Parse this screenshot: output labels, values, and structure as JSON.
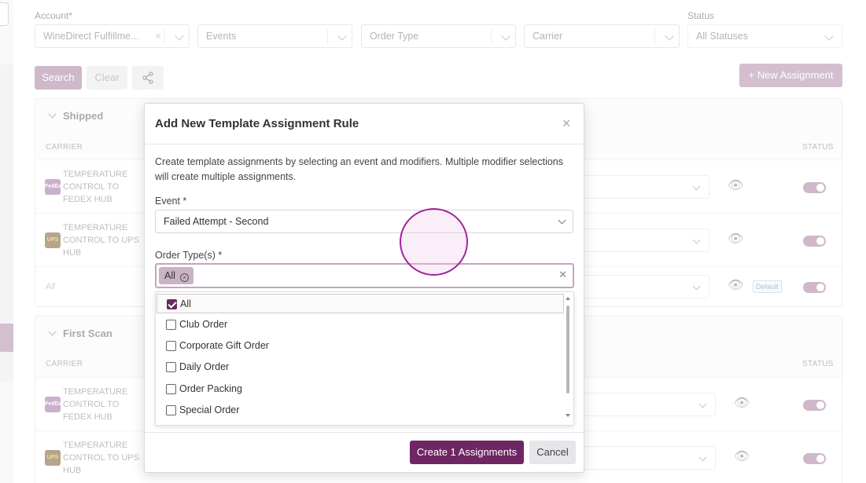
{
  "filters": {
    "account_label": "Account*",
    "account_value": "WineDirect Fulfillme...",
    "events_placeholder": "Events",
    "order_type_placeholder": "Order Type",
    "carrier_placeholder": "Carrier",
    "status_label": "Status",
    "status_value": "All Statuses"
  },
  "toolbar": {
    "search_label": "Search",
    "clear_label": "Clear",
    "new_assignment_label": "+ New Assignment"
  },
  "sections": [
    {
      "title": "Shipped",
      "col_carrier": "CARRIER",
      "col_status": "STATUS",
      "rows": [
        {
          "carrier": "TEMPERATURE CONTROL TO FEDEX HUB",
          "logo": "FedEx"
        },
        {
          "carrier": "TEMPERATURE CONTROL TO UPS HUB",
          "logo": "UPS"
        },
        {
          "carrier": "All",
          "badge": "Default"
        }
      ]
    },
    {
      "title": "First Scan",
      "col_carrier": "CARRIER",
      "col_status": "STATUS",
      "rows": [
        {
          "carrier": "TEMPERATURE CONTROL TO FEDEX HUB",
          "logo": "FedEx"
        },
        {
          "carrier": "TEMPERATURE CONTROL TO UPS HUB",
          "logo": "UPS"
        }
      ]
    }
  ],
  "modal": {
    "title": "Add New Template Assignment Rule",
    "description": "Create template assignments by selecting an event and modifiers. Multiple modifier selections will create multiple assignments.",
    "event_label": "Event *",
    "event_value": "Failed Attempt - Second",
    "order_types_label": "Order Type(s) *",
    "chip_label": "All",
    "options": [
      {
        "label": "All",
        "checked": true
      },
      {
        "label": "Club Order",
        "checked": false
      },
      {
        "label": "Corporate Gift Order",
        "checked": false
      },
      {
        "label": "Daily Order",
        "checked": false
      },
      {
        "label": "Order Packing",
        "checked": false
      },
      {
        "label": "Special Order",
        "checked": false
      }
    ],
    "create_label": "Create 1 Assignments",
    "cancel_label": "Cancel"
  },
  "icons": {
    "close": "close-icon",
    "share": "share-icon",
    "eye": "eye-icon",
    "chevron": "chevron-down-icon"
  },
  "colors": {
    "accent": "#6f2664",
    "accent_light": "#a67e9f"
  }
}
